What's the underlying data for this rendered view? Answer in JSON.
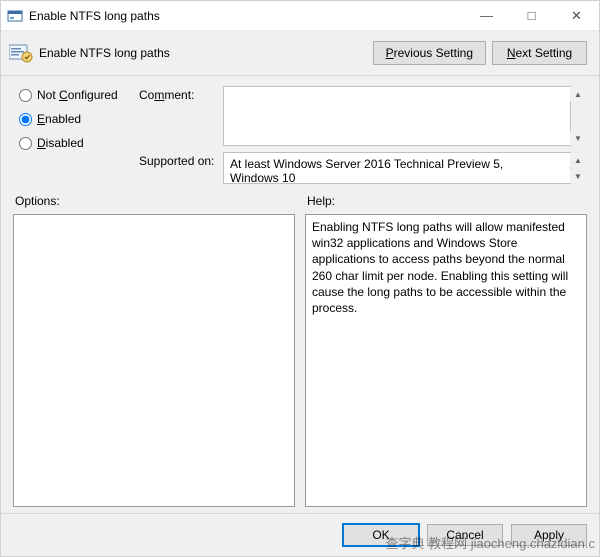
{
  "titlebar": {
    "title": "Enable NTFS long paths"
  },
  "header": {
    "title": "Enable NTFS long paths",
    "prev_btn": "Previous Setting",
    "next_btn": "Next Setting"
  },
  "radios": {
    "not_configured": "Not Configured",
    "enabled": "Enabled",
    "disabled": "Disabled",
    "selected": "enabled"
  },
  "fields": {
    "comment_label": "Comment:",
    "comment_value": "",
    "supported_label": "Supported on:",
    "supported_value": "At least Windows Server 2016 Technical Preview 5, Windows 10"
  },
  "panes": {
    "options_label": "Options:",
    "options_content": "",
    "help_label": "Help:",
    "help_content": "Enabling NTFS long paths will allow manifested win32 applications and Windows Store applications to access paths beyond the normal 260 char limit per node.  Enabling this setting will cause the long paths to be accessible within the process."
  },
  "footer": {
    "ok": "OK",
    "cancel": "Cancel",
    "apply": "Apply"
  },
  "watermark": "查字典 教程网 jiaocheng.chazidian.c"
}
